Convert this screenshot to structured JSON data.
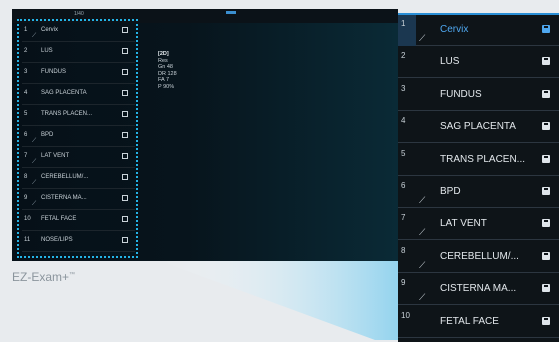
{
  "monitor": {
    "top_label": "1/40",
    "mini_list": [
      {
        "num": "1",
        "label": "Cervix",
        "probe": true
      },
      {
        "num": "2",
        "label": "LUS",
        "probe": false
      },
      {
        "num": "3",
        "label": "FUNDUS",
        "probe": false
      },
      {
        "num": "4",
        "label": "SAG PLACENTA",
        "probe": false
      },
      {
        "num": "5",
        "label": "TRANS PLACEN...",
        "probe": false
      },
      {
        "num": "6",
        "label": "BPD",
        "probe": true
      },
      {
        "num": "7",
        "label": "LAT VENT",
        "probe": true
      },
      {
        "num": "8",
        "label": "CEREBELLUM/...",
        "probe": true
      },
      {
        "num": "9",
        "label": "CISTERNA MA...",
        "probe": true
      },
      {
        "num": "10",
        "label": "FETAL FACE",
        "probe": false
      },
      {
        "num": "11",
        "label": "NOSE/LIPS",
        "probe": false
      }
    ],
    "info": {
      "mode": "[2D]",
      "lines": [
        "Res",
        "Gn  48",
        "DR  128",
        "FA  7",
        "P   90%"
      ]
    }
  },
  "caption": {
    "text": "EZ-Exam+",
    "tm": "™"
  },
  "panel": {
    "selected_color": "#4fa8f0",
    "rows": [
      {
        "num": "1",
        "label": "Cervix",
        "probe": true,
        "selected": true
      },
      {
        "num": "2",
        "label": "LUS",
        "probe": false,
        "selected": false
      },
      {
        "num": "3",
        "label": "FUNDUS",
        "probe": false,
        "selected": false
      },
      {
        "num": "4",
        "label": "SAG PLACENTA",
        "probe": false,
        "selected": false
      },
      {
        "num": "5",
        "label": "TRANS PLACEN...",
        "probe": false,
        "selected": false
      },
      {
        "num": "6",
        "label": "BPD",
        "probe": true,
        "selected": false
      },
      {
        "num": "7",
        "label": "LAT VENT",
        "probe": true,
        "selected": false
      },
      {
        "num": "8",
        "label": "CEREBELLUM/...",
        "probe": true,
        "selected": false
      },
      {
        "num": "9",
        "label": "CISTERNA MA...",
        "probe": true,
        "selected": false
      },
      {
        "num": "10",
        "label": "FETAL FACE",
        "probe": false,
        "selected": false
      }
    ]
  }
}
